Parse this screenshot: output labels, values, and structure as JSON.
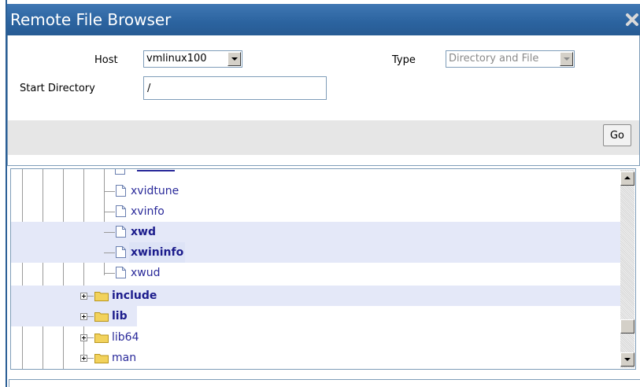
{
  "window": {
    "title": "Remote File Browser"
  },
  "form": {
    "host_label": "Host",
    "host_value": "vmlinux100",
    "type_label": "Type",
    "type_value": "Directory and File",
    "start_dir_label": "Start Directory",
    "start_dir_value": "/"
  },
  "actions": {
    "go_label": "Go"
  },
  "tree": {
    "files": [
      {
        "name": "xvidtune",
        "highlighted": false
      },
      {
        "name": "xvinfo",
        "highlighted": false
      },
      {
        "name": "xwd",
        "highlighted": true
      },
      {
        "name": "xwininfo",
        "highlighted": true
      },
      {
        "name": "xwud",
        "highlighted": false
      }
    ],
    "folders": [
      {
        "name": "include",
        "highlighted": true
      },
      {
        "name": "lib",
        "highlighted": true
      },
      {
        "name": "lib64",
        "highlighted": false
      },
      {
        "name": "man",
        "highlighted": false
      }
    ]
  },
  "colors": {
    "titlebar": "#2b639f",
    "link": "#2a2a9a",
    "highlight": "#e4e8f8",
    "folder": "#f2d25c"
  }
}
